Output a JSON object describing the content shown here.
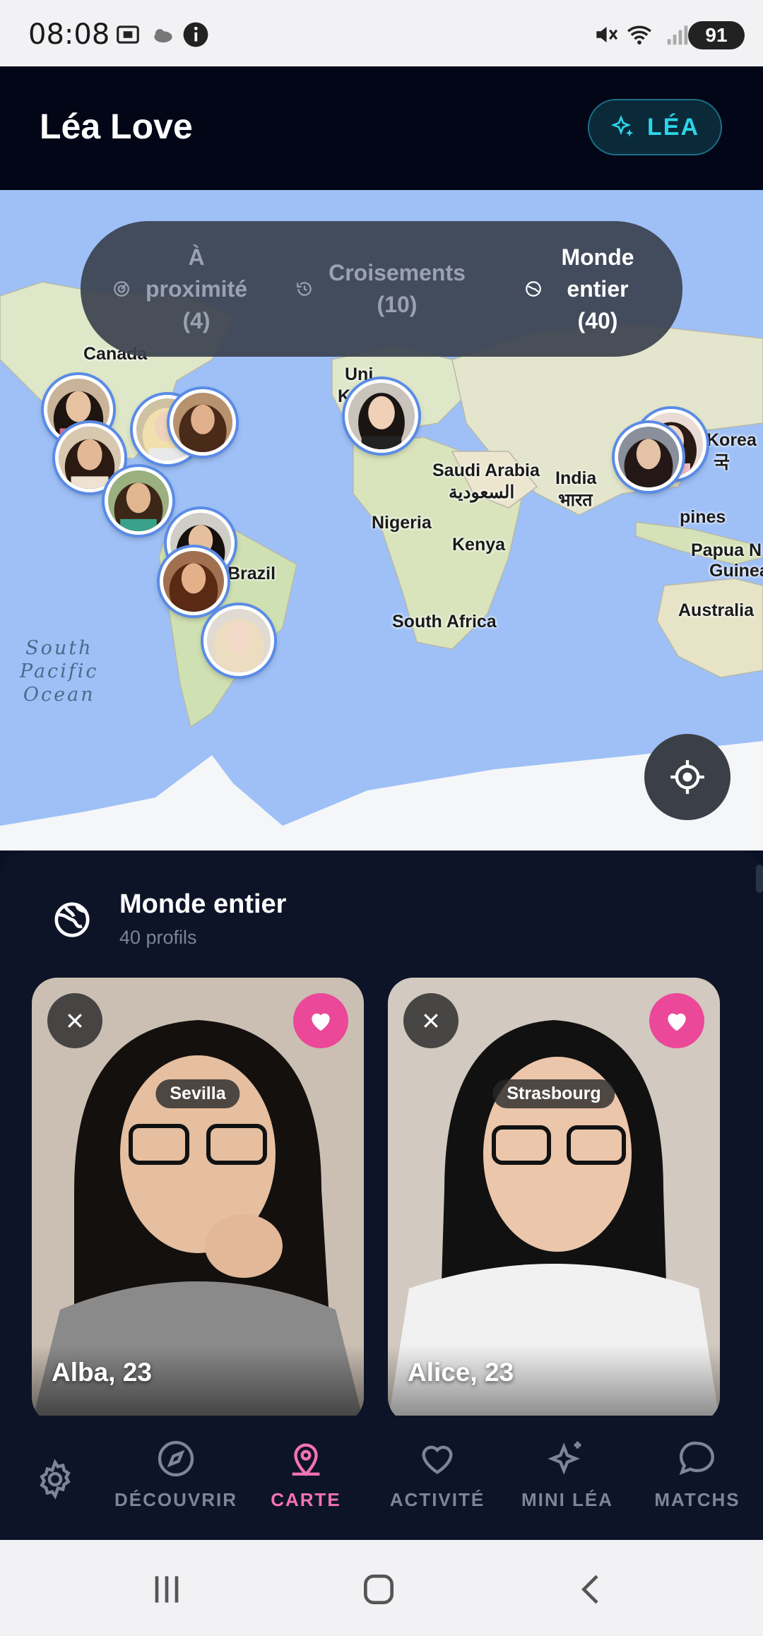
{
  "status_bar": {
    "time": "08:08",
    "battery": "91"
  },
  "header": {
    "title": "Léa Love",
    "lea_button": "LÉA"
  },
  "map": {
    "segments": [
      {
        "label": "À proximité (4)",
        "active": false,
        "icon": "radar-icon"
      },
      {
        "label": "Croisements (10)",
        "active": false,
        "icon": "history-icon"
      },
      {
        "label": "Monde entier (40)",
        "active": true,
        "icon": "globe-icon"
      }
    ],
    "labels": {
      "canada": "Canada",
      "united": "Uni",
      "united2": "K",
      "saudi": "Saudi Arabia",
      "saudi_ar": "السعودية",
      "india": "India",
      "india_hi": "भारत",
      "korea": "Korea",
      "korea2": "국",
      "nigeria": "Nigeria",
      "kenya": "Kenya",
      "brazil": "Brazil",
      "philippines": "pines",
      "papua": "Papua N",
      "guinea": "Guinea",
      "australia": "Australia",
      "south_africa": "South Africa",
      "ocean_1": "South",
      "ocean_2": "Pacific",
      "ocean_3": "Ocean"
    }
  },
  "sheet": {
    "title": "Monde entier",
    "subtitle": "40 profils",
    "cards": [
      {
        "name": "Alba, 23",
        "city": "Sevilla",
        "hoodie": "#8a8a8a",
        "bg": "#c7bdb2"
      },
      {
        "name": "Alice, 23",
        "city": "Strasbourg",
        "hoodie": "#f1f1f1",
        "bg": "#cfc6bd"
      }
    ]
  },
  "bottom_nav": {
    "items": [
      {
        "label": "DÉCOUVRIR",
        "icon": "compass-icon",
        "active": false
      },
      {
        "label": "CARTE",
        "icon": "map-pin-icon",
        "active": true
      },
      {
        "label": "ACTIVITÉ",
        "icon": "heart-icon",
        "active": false
      },
      {
        "label": "MINI LÉA",
        "icon": "sparkles-icon",
        "active": false
      },
      {
        "label": "MATCHS",
        "icon": "chat-bubble-icon",
        "active": false
      }
    ]
  },
  "colors": {
    "accent": "#ec4899",
    "teal": "#2dd4e8",
    "map_water": "#9ec0f7"
  }
}
